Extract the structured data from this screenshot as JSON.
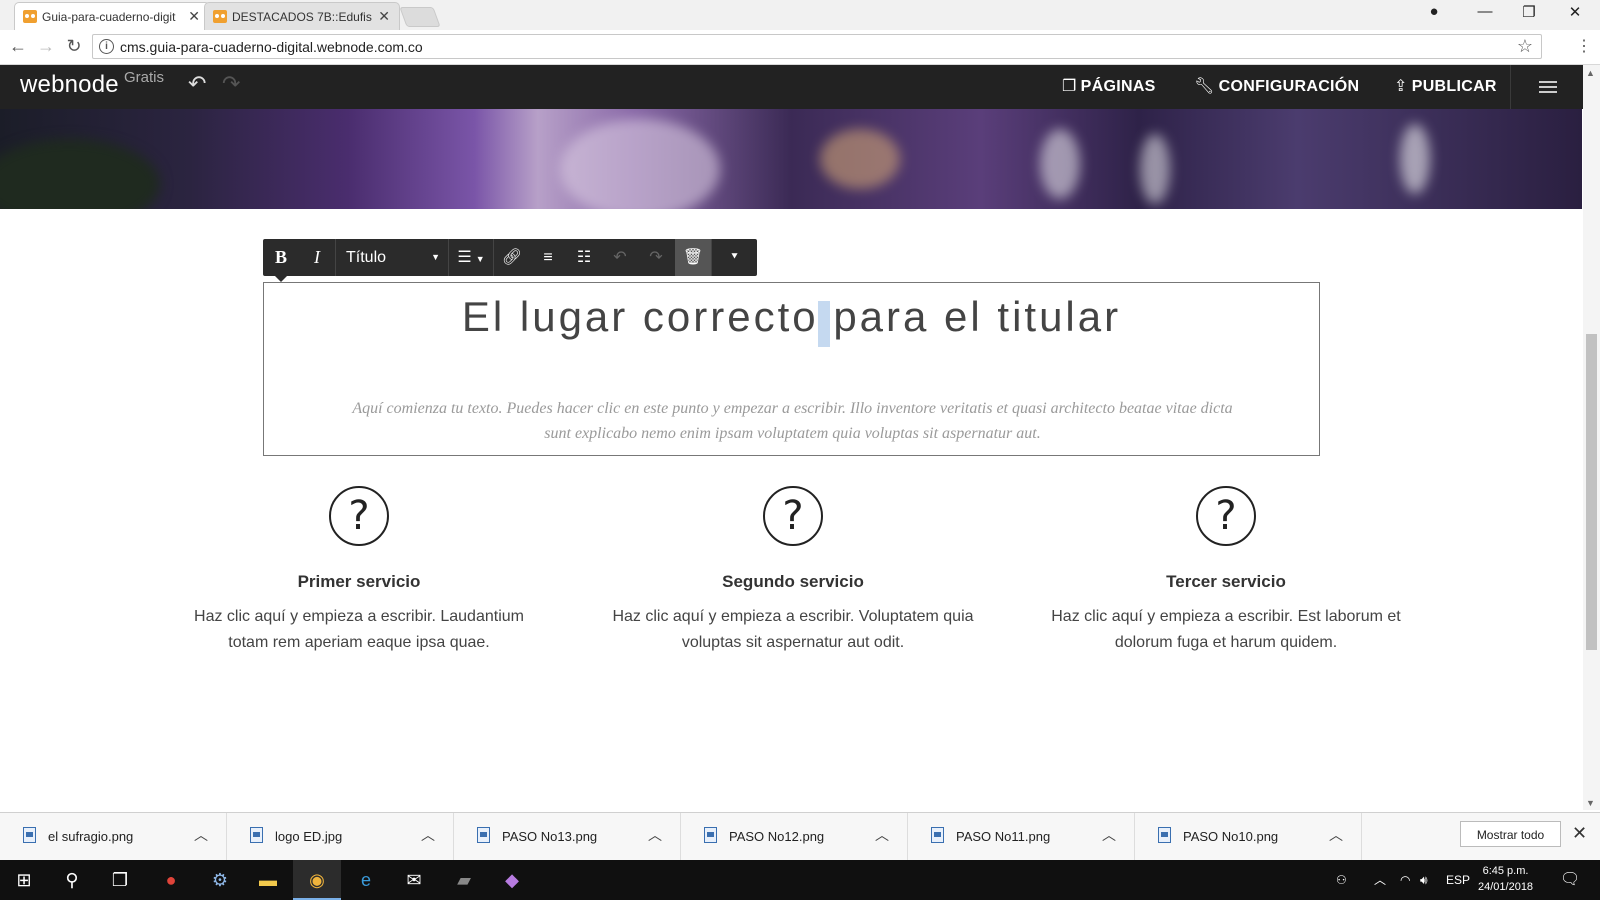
{
  "browser": {
    "tabs": [
      {
        "title": "Guia-para-cuaderno-digit",
        "active": true
      },
      {
        "title": "DESTACADOS 7B::Edufisi",
        "active": false
      }
    ],
    "url": "cms.guia-para-cuaderno-digital.webnode.com.co"
  },
  "webnode": {
    "logo": "webnode",
    "plan": "Gratis",
    "nav": {
      "pages": "PÁGINAS",
      "settings": "CONFIGURACIÓN",
      "publish": "PUBLICAR"
    }
  },
  "toolbar": {
    "bold": "B",
    "italic": "I",
    "style_select": "Título"
  },
  "content": {
    "headline": "El lugar correcto para el titular",
    "intro": "Aquí comienza tu texto. Puedes hacer clic en este punto y empezar a escribir. Illo inventore veritatis et quasi architecto beatae vitae dicta sunt explicabo nemo enim ipsam voluptatem quia voluptas sit aspernatur aut.",
    "services": [
      {
        "icon": "?",
        "title": "Primer servicio",
        "text": "Haz clic aquí y empieza a escribir. Laudantium totam rem aperiam eaque ipsa quae."
      },
      {
        "icon": "?",
        "title": "Segundo servicio",
        "text": "Haz clic aquí y empieza a escribir. Voluptatem quia voluptas sit aspernatur aut odit."
      },
      {
        "icon": "?",
        "title": "Tercer servicio",
        "text": "Haz clic aquí y empieza a escribir. Est laborum et dolorum fuga et harum quidem."
      }
    ]
  },
  "downloads": {
    "items": [
      "el sufragio.png",
      "logo ED.jpg",
      "PASO No13.png",
      "PASO No12.png",
      "PASO No11.png",
      "PASO No10.png"
    ],
    "show_all": "Mostrar todo"
  },
  "taskbar": {
    "lang": "ESP",
    "time": "6:45 p.m.",
    "date": "24/01/2018"
  },
  "colors": {
    "topbar": "#222222",
    "toolbar": "#2b2b2b",
    "selection": "#c5d9f0"
  }
}
